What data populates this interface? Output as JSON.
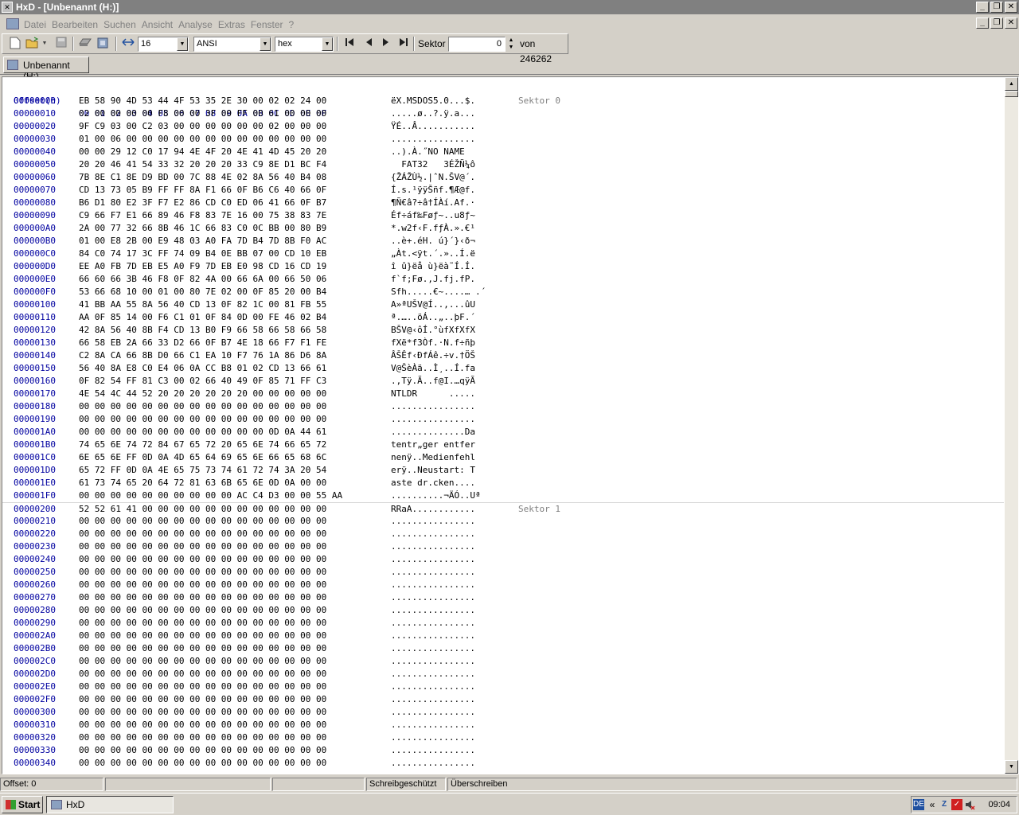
{
  "window": {
    "title": "HxD - [Unbenannt (H:)]",
    "minimize_glyph": "_",
    "maximize_glyph": "❐",
    "close_glyph": "✕"
  },
  "menu": {
    "items": [
      "Datei",
      "Bearbeiten",
      "Suchen",
      "Ansicht",
      "Analyse",
      "Extras",
      "Fenster",
      "?"
    ]
  },
  "toolbar": {
    "bytes_per_row": "16",
    "charset": "ANSI",
    "offset_base": "hex",
    "sector_label": "Sektor",
    "sector_value": "0",
    "sector_total": "von 246262"
  },
  "tab": {
    "label": "Unbenannt (H:)"
  },
  "hex": {
    "header_offset": "Offset(h)",
    "header_columns": "00 01 02 03 04 05 06 07 08 09 0A 0B 0C 0D 0E 0F",
    "rows": [
      {
        "offset": "00000000",
        "bytes": "EB 58 90 4D 53 44 4F 53 35 2E 30 00 02 02 24 00",
        "ascii": "ëX.MSDOS5.0...$.",
        "sector": "Sektor 0"
      },
      {
        "offset": "00000010",
        "bytes": "02 00 00 00 00 F8 00 00 3F 00 FF 00 61 00 00 00",
        "ascii": ".....ø..?.ÿ.a...",
        "sector": ""
      },
      {
        "offset": "00000020",
        "bytes": "9F C9 03 00 C2 03 00 00 00 00 00 00 02 00 00 00",
        "ascii": "ŸÉ..Â...........",
        "sector": ""
      },
      {
        "offset": "00000030",
        "bytes": "01 00 06 00 00 00 00 00 00 00 00 00 00 00 00 00",
        "ascii": "................",
        "sector": ""
      },
      {
        "offset": "00000040",
        "bytes": "00 00 29 12 C0 17 94 4E 4F 20 4E 41 4D 45 20 20",
        "ascii": "..).À.˝NO NAME  ",
        "sector": ""
      },
      {
        "offset": "00000050",
        "bytes": "20 20 46 41 54 33 32 20 20 20 33 C9 8E D1 BC F4",
        "ascii": "  FAT32   3ÉŽÑ¼ô",
        "sector": ""
      },
      {
        "offset": "00000060",
        "bytes": "7B 8E C1 8E D9 BD 00 7C 88 4E 02 8A 56 40 B4 08",
        "ascii": "{ŽÁŽÙ½.|ˆN.ŠV@´.",
        "sector": ""
      },
      {
        "offset": "00000070",
        "bytes": "CD 13 73 05 B9 FF FF 8A F1 66 0F B6 C6 40 66 0F",
        "ascii": "Í.s.¹ÿÿŠñf.¶Æ@f.",
        "sector": ""
      },
      {
        "offset": "00000080",
        "bytes": "B6 D1 80 E2 3F F7 E2 86 CD C0 ED 06 41 66 0F B7",
        "ascii": "¶Ñ€â?÷â†ÍÀí.Af.·",
        "sector": ""
      },
      {
        "offset": "00000090",
        "bytes": "C9 66 F7 E1 66 89 46 F8 83 7E 16 00 75 38 83 7E",
        "ascii": "Éf÷áf‰Føƒ~..u8ƒ~",
        "sector": ""
      },
      {
        "offset": "000000A0",
        "bytes": "2A 00 77 32 66 8B 46 1C 66 83 C0 0C BB 00 80 B9",
        "ascii": "*.w2f‹F.fƒÀ.».€¹",
        "sector": ""
      },
      {
        "offset": "000000B0",
        "bytes": "01 00 E8 2B 00 E9 48 03 A0 FA 7D B4 7D 8B F0 AC",
        "ascii": "..è+.éH. ú}´}‹ð¬",
        "sector": ""
      },
      {
        "offset": "000000C0",
        "bytes": "84 C0 74 17 3C FF 74 09 B4 0E BB 07 00 CD 10 EB",
        "ascii": "„Àt.<ÿt.´.»..Í.ë",
        "sector": ""
      },
      {
        "offset": "000000D0",
        "bytes": "EE A0 FB 7D EB E5 A0 F9 7D EB E0 98 CD 16 CD 19",
        "ascii": "î û}ëå ù}ëà˜Í.Í.",
        "sector": ""
      },
      {
        "offset": "000000E0",
        "bytes": "66 60 66 3B 46 F8 0F 82 4A 00 66 6A 00 66 50 06",
        "ascii": "f`f;Fø.‚J.fj.fP.",
        "sector": ""
      },
      {
        "offset": "000000F0",
        "bytes": "53 66 68 10 00 01 00 80 7E 02 00 0F 85 20 00 B4",
        "ascii": "Sfh.....€~....… .´",
        "sector": ""
      },
      {
        "offset": "00000100",
        "bytes": "41 BB AA 55 8A 56 40 CD 13 0F 82 1C 00 81 FB 55",
        "ascii": "A»ªUŠV@Í..‚...ûU",
        "sector": ""
      },
      {
        "offset": "00000110",
        "bytes": "AA 0F 85 14 00 F6 C1 01 0F 84 0D 00 FE 46 02 B4",
        "ascii": "ª.…..öÁ..„..þF.´",
        "sector": ""
      },
      {
        "offset": "00000120",
        "bytes": "42 8A 56 40 8B F4 CD 13 B0 F9 66 58 66 58 66 58",
        "ascii": "BŠV@‹ôÍ.°ùfXfXfX",
        "sector": ""
      },
      {
        "offset": "00000130",
        "bytes": "66 58 EB 2A 66 33 D2 66 0F B7 4E 18 66 F7 F1 FE",
        "ascii": "fXë*f3Òf.·N.f÷ñþ",
        "sector": ""
      },
      {
        "offset": "00000140",
        "bytes": "C2 8A CA 66 8B D0 66 C1 EA 10 F7 76 1A 86 D6 8A",
        "ascii": "ÂŠÊf‹ÐfÁê.÷v.†ÖŠ",
        "sector": ""
      },
      {
        "offset": "00000150",
        "bytes": "56 40 8A E8 C0 E4 06 0A CC B8 01 02 CD 13 66 61",
        "ascii": "V@ŠèÀä..Ì¸..Í.fa",
        "sector": ""
      },
      {
        "offset": "00000160",
        "bytes": "0F 82 54 FF 81 C3 00 02 66 40 49 0F 85 71 FF C3",
        "ascii": ".‚Tÿ.Ã..f@I.…qÿÃ",
        "sector": ""
      },
      {
        "offset": "00000170",
        "bytes": "4E 54 4C 44 52 20 20 20 20 20 20 00 00 00 00 00",
        "ascii": "NTLDR      .....",
        "sector": ""
      },
      {
        "offset": "00000180",
        "bytes": "00 00 00 00 00 00 00 00 00 00 00 00 00 00 00 00",
        "ascii": "................",
        "sector": ""
      },
      {
        "offset": "00000190",
        "bytes": "00 00 00 00 00 00 00 00 00 00 00 00 00 00 00 00",
        "ascii": "................",
        "sector": ""
      },
      {
        "offset": "000001A0",
        "bytes": "00 00 00 00 00 00 00 00 00 00 00 00 0D 0A 44 61",
        "ascii": "..............Da",
        "sector": ""
      },
      {
        "offset": "000001B0",
        "bytes": "74 65 6E 74 72 84 67 65 72 20 65 6E 74 66 65 72",
        "ascii": "tentr„ger entfer",
        "sector": ""
      },
      {
        "offset": "000001C0",
        "bytes": "6E 65 6E FF 0D 0A 4D 65 64 69 65 6E 66 65 68 6C",
        "ascii": "nenÿ..Medienfehl",
        "sector": ""
      },
      {
        "offset": "000001D0",
        "bytes": "65 72 FF 0D 0A 4E 65 75 73 74 61 72 74 3A 20 54",
        "ascii": "erÿ..Neustart: T",
        "sector": ""
      },
      {
        "offset": "000001E0",
        "bytes": "61 73 74 65 20 64 72 81 63 6B 65 6E 0D 0A 00 00",
        "ascii": "aste dr.cken....",
        "sector": ""
      },
      {
        "offset": "000001F0",
        "bytes": "00 00 00 00 00 00 00 00 00 00 AC C4 D3 00 00 55 AA",
        "ascii": "..........¬ÄÓ..Uª",
        "sector": ""
      },
      {
        "offset": "00000200",
        "bytes": "52 52 61 41 00 00 00 00 00 00 00 00 00 00 00 00",
        "ascii": "RRaA............",
        "sector": "Sektor 1"
      },
      {
        "offset": "00000210",
        "bytes": "00 00 00 00 00 00 00 00 00 00 00 00 00 00 00 00",
        "ascii": "................",
        "sector": ""
      },
      {
        "offset": "00000220",
        "bytes": "00 00 00 00 00 00 00 00 00 00 00 00 00 00 00 00",
        "ascii": "................",
        "sector": ""
      },
      {
        "offset": "00000230",
        "bytes": "00 00 00 00 00 00 00 00 00 00 00 00 00 00 00 00",
        "ascii": "................",
        "sector": ""
      },
      {
        "offset": "00000240",
        "bytes": "00 00 00 00 00 00 00 00 00 00 00 00 00 00 00 00",
        "ascii": "................",
        "sector": ""
      },
      {
        "offset": "00000250",
        "bytes": "00 00 00 00 00 00 00 00 00 00 00 00 00 00 00 00",
        "ascii": "................",
        "sector": ""
      },
      {
        "offset": "00000260",
        "bytes": "00 00 00 00 00 00 00 00 00 00 00 00 00 00 00 00",
        "ascii": "................",
        "sector": ""
      },
      {
        "offset": "00000270",
        "bytes": "00 00 00 00 00 00 00 00 00 00 00 00 00 00 00 00",
        "ascii": "................",
        "sector": ""
      },
      {
        "offset": "00000280",
        "bytes": "00 00 00 00 00 00 00 00 00 00 00 00 00 00 00 00",
        "ascii": "................",
        "sector": ""
      },
      {
        "offset": "00000290",
        "bytes": "00 00 00 00 00 00 00 00 00 00 00 00 00 00 00 00",
        "ascii": "................",
        "sector": ""
      },
      {
        "offset": "000002A0",
        "bytes": "00 00 00 00 00 00 00 00 00 00 00 00 00 00 00 00",
        "ascii": "................",
        "sector": ""
      },
      {
        "offset": "000002B0",
        "bytes": "00 00 00 00 00 00 00 00 00 00 00 00 00 00 00 00",
        "ascii": "................",
        "sector": ""
      },
      {
        "offset": "000002C0",
        "bytes": "00 00 00 00 00 00 00 00 00 00 00 00 00 00 00 00",
        "ascii": "................",
        "sector": ""
      },
      {
        "offset": "000002D0",
        "bytes": "00 00 00 00 00 00 00 00 00 00 00 00 00 00 00 00",
        "ascii": "................",
        "sector": ""
      },
      {
        "offset": "000002E0",
        "bytes": "00 00 00 00 00 00 00 00 00 00 00 00 00 00 00 00",
        "ascii": "................",
        "sector": ""
      },
      {
        "offset": "000002F0",
        "bytes": "00 00 00 00 00 00 00 00 00 00 00 00 00 00 00 00",
        "ascii": "................",
        "sector": ""
      },
      {
        "offset": "00000300",
        "bytes": "00 00 00 00 00 00 00 00 00 00 00 00 00 00 00 00",
        "ascii": "................",
        "sector": ""
      },
      {
        "offset": "00000310",
        "bytes": "00 00 00 00 00 00 00 00 00 00 00 00 00 00 00 00",
        "ascii": "................",
        "sector": ""
      },
      {
        "offset": "00000320",
        "bytes": "00 00 00 00 00 00 00 00 00 00 00 00 00 00 00 00",
        "ascii": "................",
        "sector": ""
      },
      {
        "offset": "00000330",
        "bytes": "00 00 00 00 00 00 00 00 00 00 00 00 00 00 00 00",
        "ascii": "................",
        "sector": ""
      },
      {
        "offset": "00000340",
        "bytes": "00 00 00 00 00 00 00 00 00 00 00 00 00 00 00 00",
        "ascii": "................",
        "sector": ""
      }
    ]
  },
  "status": {
    "offset": "Offset: 0",
    "panel2": "",
    "panel3": "",
    "readonly": "Schreibgeschützt",
    "mode": "Überschreiben"
  },
  "taskbar": {
    "start_label": "Start",
    "task_label": "HxD",
    "language": "DE",
    "clock": "09:04"
  }
}
